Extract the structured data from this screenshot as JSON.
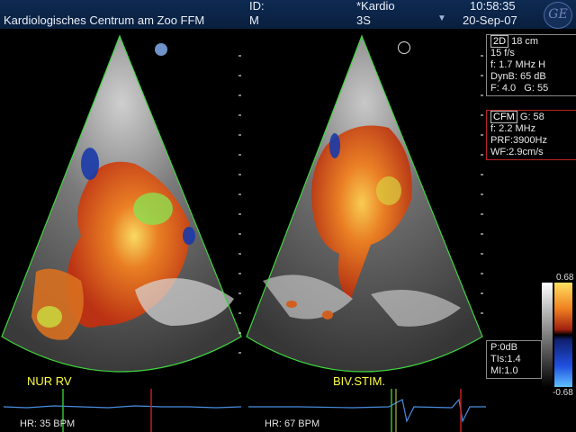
{
  "header": {
    "clinic": "Kardiologisches Centrum am Zoo FFM",
    "id_label": "ID:",
    "mode_label": "M",
    "preset": "*Kardio",
    "probe": "3S",
    "time": "10:58:35",
    "date": "20-Sep-07",
    "logo": "GE"
  },
  "left_pane": {
    "label": "NUR RV",
    "hr": "HR: 35 BPM"
  },
  "right_pane": {
    "label": "BIV.STIM.",
    "hr": "HR: 67 BPM"
  },
  "params_2d": {
    "tag": "2D",
    "depth": "18 cm",
    "rate": "15 f/s",
    "freq": "f: 1.7 MHz H",
    "dynb": "DynB: 65 dB",
    "focus": "F: 4.0",
    "gain": "G: 55"
  },
  "params_cfm": {
    "tag": "CFM",
    "gain": "G: 58",
    "freq": "f: 2.2 MHz",
    "prf": "PRF:3900Hz",
    "wf": "WF:2.9cm/s"
  },
  "power": {
    "p": "P:0dB",
    "tis": "TIs:1.4",
    "mi": "MI:1.0"
  },
  "color_scale": {
    "max": "0.68",
    "min": "-0.68"
  },
  "colors": {
    "header_bg": "#0a1f3e",
    "sector_outline": "#3fd43f",
    "label_yellow": "#ffff40",
    "ecg_line": "#4a8ee0",
    "marker_red": "#c02020",
    "marker_green": "#30c030"
  }
}
